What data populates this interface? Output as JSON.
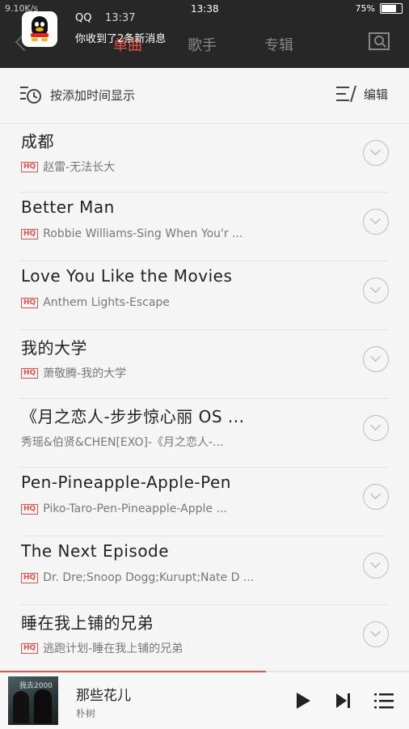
{
  "status_bar": {
    "left": "9.10K/s",
    "time": "13:38",
    "battery": "75%",
    "battery_level": 0.75
  },
  "notification": {
    "app": "QQ",
    "time": "13:37",
    "message": "你收到了2条新消息"
  },
  "tabs": [
    {
      "label": "单曲",
      "active": true
    },
    {
      "label": "歌手",
      "active": false
    },
    {
      "label": "专辑",
      "active": false
    }
  ],
  "sort_bar": {
    "sort_label": "按添加时间显示",
    "edit_label": "编辑"
  },
  "songs": [
    {
      "title": "成都",
      "artist": "赵雷-无法长大",
      "hq": "HQ"
    },
    {
      "title": "Better Man",
      "artist": "Robbie Williams-Sing When You'r ...",
      "hq": "HQ"
    },
    {
      "title": "Love You Like the Movies",
      "artist": "Anthem Lights-Escape",
      "hq": "HQ"
    },
    {
      "title": "我的大学",
      "artist": "萧敬腾-我的大学",
      "hq": "HQ"
    },
    {
      "title": "《月之恋人-步步惊心丽 OS ...",
      "artist": "秀瑶&伯贤&CHEN[EXO]-《月之恋人-...",
      "hq": ""
    },
    {
      "title": "Pen-Pineapple-Apple-Pen",
      "artist": "Piko-Taro-Pen-Pineapple-Apple ...",
      "hq": "HQ"
    },
    {
      "title": "The Next Episode",
      "artist": "Dr. Dre;Snoop Dogg;Kurupt;Nate D ...",
      "hq": "HQ"
    },
    {
      "title": "睡在我上铺的兄弟",
      "artist": "逃跑计划-睡在我上铺的兄弟",
      "hq": "HQ"
    }
  ],
  "player": {
    "title": "那些花儿",
    "artist": "朴树",
    "progress": 0.65,
    "cover_text": "我去2000年"
  },
  "colors": {
    "accent": "#e8524a"
  }
}
